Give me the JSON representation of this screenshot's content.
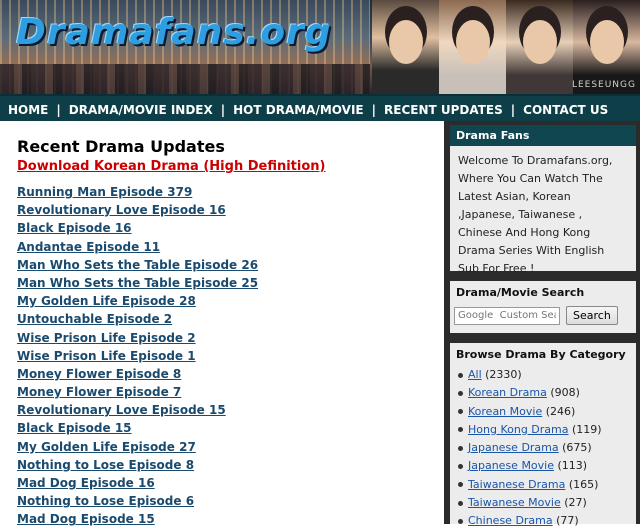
{
  "header": {
    "logo": "Dramafans.org",
    "watermark": "LEESEUNGG"
  },
  "nav": [
    "HOME",
    "DRAMA/MOVIE INDEX",
    "HOT DRAMA/MOVIE",
    "RECENT UPDATES",
    "CONTACT US"
  ],
  "main": {
    "heading": "Recent Drama Updates",
    "download_link": "Download Korean Drama (High Definition)",
    "episodes": [
      "Running Man Episode 379",
      "Revolutionary Love Episode 16",
      "Black Episode 16",
      "Andantae Episode 11",
      "Man Who Sets the Table Episode 26",
      "Man Who Sets the Table Episode 25",
      "My Golden Life Episode 28",
      "Untouchable Episode 2",
      "Wise Prison Life Episode 2",
      "Wise Prison Life Episode 1",
      "Money Flower Episode 8",
      "Money Flower Episode 7",
      "Revolutionary Love Episode 15",
      "Black Episode 15",
      "My Golden Life Episode 27",
      "Nothing to Lose Episode 8",
      "Mad Dog Episode 16",
      "Nothing to Lose Episode 6",
      "Mad Dog Episode 15"
    ]
  },
  "sidebar": {
    "fans": {
      "title": "Drama Fans",
      "text": "Welcome To Dramafans.org, Where You Can Watch The Latest Asian, Korean ,Japanese, Taiwanese , Chinese And Hong Kong Drama Series With English Sub For Free !"
    },
    "search": {
      "title": "Drama/Movie Search",
      "placeholder": "Google  Custom Sea",
      "button": "Search"
    },
    "categories": {
      "title": "Browse Drama By Category",
      "items": [
        {
          "name": "All",
          "count": "(2330)"
        },
        {
          "name": "Korean Drama",
          "count": "(908)"
        },
        {
          "name": "Korean Movie",
          "count": "(246)"
        },
        {
          "name": "Hong Kong Drama",
          "count": "(119)"
        },
        {
          "name": "Japanese Drama",
          "count": "(675)"
        },
        {
          "name": "Japanese Movie",
          "count": "(113)"
        },
        {
          "name": "Taiwanese Drama",
          "count": "(165)"
        },
        {
          "name": "Taiwanese Movie",
          "count": "(27)"
        },
        {
          "name": "Chinese Drama",
          "count": "(77)"
        }
      ]
    }
  }
}
